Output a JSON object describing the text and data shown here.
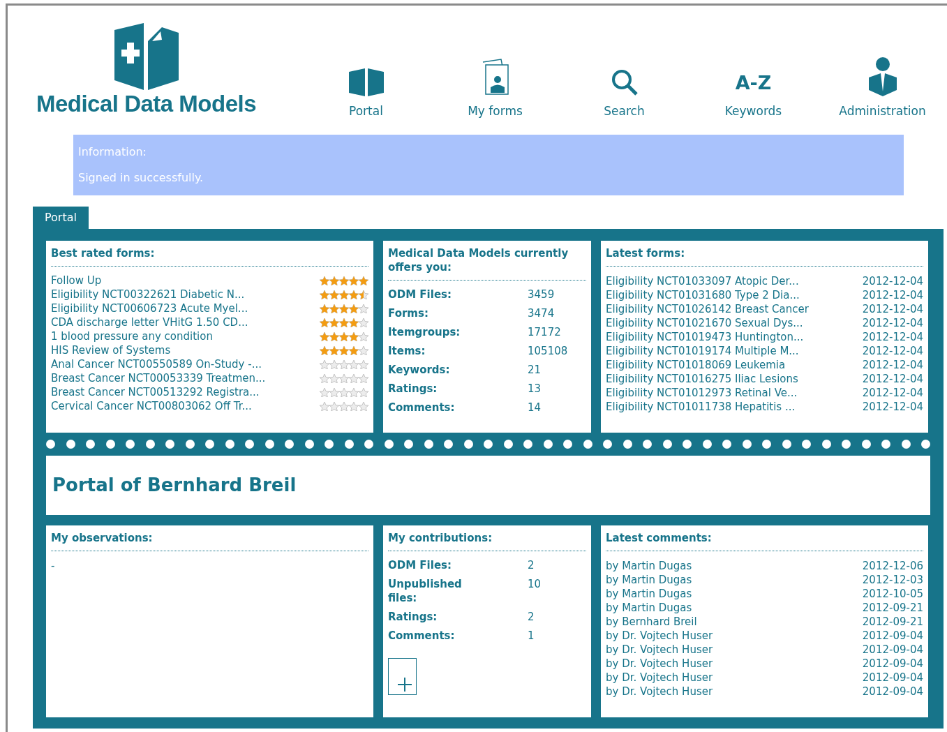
{
  "brand": {
    "name": "Medical Data Models"
  },
  "nav": [
    {
      "label": "Portal",
      "kind": "portal"
    },
    {
      "label": "My forms",
      "kind": "forms"
    },
    {
      "label": "Search",
      "kind": "search"
    },
    {
      "label": "Keywords",
      "kind": "text",
      "glyph": "A-Z"
    },
    {
      "label": "Administration",
      "kind": "admin"
    }
  ],
  "info": {
    "title": "Information:",
    "message": "Signed in successfully."
  },
  "tabs": [
    {
      "label": "Portal",
      "selected": true
    }
  ],
  "best_rated": {
    "title": "Best rated forms:",
    "items": [
      {
        "name": "Follow Up",
        "stars": 5
      },
      {
        "name": "Eligibility NCT00322621 Diabetic N...",
        "stars": 4.5
      },
      {
        "name": "Eligibility NCT00606723 Acute Myel...",
        "stars": 4
      },
      {
        "name": "CDA discharge letter VHitG 1.50 CD...",
        "stars": 4
      },
      {
        "name": "1 blood pressure any condition",
        "stars": 4
      },
      {
        "name": "HIS Review of Systems",
        "stars": 4
      },
      {
        "name": "Anal Cancer NCT00550589 On-Study -...",
        "stars": 0
      },
      {
        "name": "Breast Cancer NCT00053339 Treatmen...",
        "stars": 0
      },
      {
        "name": "Breast Cancer NCT00513292 Registra...",
        "stars": 0
      },
      {
        "name": "Cervical Cancer NCT00803062 Off Tr...",
        "stars": 0
      }
    ]
  },
  "offers": {
    "title": "Medical Data Models currently offers you:",
    "stats": [
      {
        "label": "ODM Files:",
        "value": "3459"
      },
      {
        "label": "Forms:",
        "value": "3474"
      },
      {
        "label": "Itemgroups:",
        "value": "17172"
      },
      {
        "label": "Items:",
        "value": "105108"
      },
      {
        "label": "Keywords:",
        "value": "21"
      },
      {
        "label": "Ratings:",
        "value": "13"
      },
      {
        "label": "Comments:",
        "value": "14"
      }
    ]
  },
  "latest_forms": {
    "title": "Latest forms:",
    "items": [
      {
        "name": "Eligibility NCT01033097 Atopic Der...",
        "date": "2012-12-04"
      },
      {
        "name": "Eligibility NCT01031680 Type 2 Dia...",
        "date": "2012-12-04"
      },
      {
        "name": "Eligibility NCT01026142 Breast Cancer",
        "date": "2012-12-04"
      },
      {
        "name": "Eligibility NCT01021670 Sexual Dys...",
        "date": "2012-12-04"
      },
      {
        "name": "Eligibility NCT01019473 Huntington...",
        "date": "2012-12-04"
      },
      {
        "name": "Eligibility NCT01019174 Multiple M...",
        "date": "2012-12-04"
      },
      {
        "name": "Eligibility NCT01018069 Leukemia",
        "date": "2012-12-04"
      },
      {
        "name": "Eligibility NCT01016275 Iliac Lesions",
        "date": "2012-12-04"
      },
      {
        "name": "Eligibility NCT01012973 Retinal Ve...",
        "date": "2012-12-04"
      },
      {
        "name": "Eligibility NCT01011738 Hepatitis ...",
        "date": "2012-12-04"
      }
    ]
  },
  "portal_title": "Portal of Bernhard Breil",
  "observations": {
    "title": "My observations:",
    "items": [
      "-"
    ]
  },
  "contributions": {
    "title": "My contributions:",
    "stats": [
      {
        "label": "ODM Files:",
        "value": "2"
      },
      {
        "label": "Unpublished files:",
        "value": "10"
      },
      {
        "label": "Ratings:",
        "value": "2"
      },
      {
        "label": "Comments:",
        "value": "1"
      }
    ]
  },
  "latest_comments": {
    "title": "Latest comments:",
    "items": [
      {
        "author": "by Martin Dugas",
        "date": "2012-12-06"
      },
      {
        "author": "by Martin Dugas",
        "date": "2012-12-03"
      },
      {
        "author": "by Martin Dugas",
        "date": "2012-10-05"
      },
      {
        "author": "by Martin Dugas",
        "date": "2012-09-21"
      },
      {
        "author": "by Bernhard Breil",
        "date": "2012-09-21"
      },
      {
        "author": "by Dr. Vojtech Huser",
        "date": "2012-09-04"
      },
      {
        "author": "by Dr. Vojtech Huser",
        "date": "2012-09-04"
      },
      {
        "author": "by Dr. Vojtech Huser",
        "date": "2012-09-04"
      },
      {
        "author": "by Dr. Vojtech Huser",
        "date": "2012-09-04"
      },
      {
        "author": "by Dr. Vojtech Huser",
        "date": "2012-09-04"
      }
    ]
  }
}
